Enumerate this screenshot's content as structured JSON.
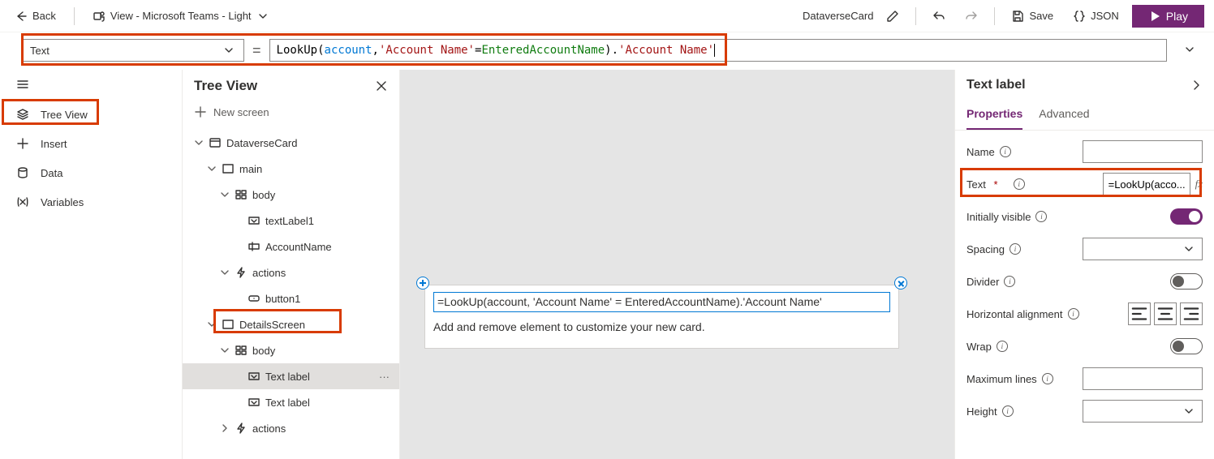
{
  "top": {
    "back": "Back",
    "view_label": "View - Microsoft Teams - Light",
    "app_name": "DataverseCard",
    "save": "Save",
    "json": "JSON",
    "play": "Play"
  },
  "formula": {
    "property_name": "Text",
    "prefix_fn": "LookUp(",
    "ident_account": "account",
    "comma1": ", ",
    "str1": "'Account Name'",
    "eq_op": " = ",
    "ident_entered": "EnteredAccountName",
    "close_dot": ").",
    "str2": "'Account Name'"
  },
  "left_nav": {
    "tree_view": "Tree View",
    "insert": "Insert",
    "data": "Data",
    "variables": "Variables"
  },
  "tree": {
    "title": "Tree View",
    "new_screen": "New screen",
    "nodes": {
      "root": "DataverseCard",
      "main": "main",
      "body1": "body",
      "textLabel1": "textLabel1",
      "accountName": "AccountName",
      "actions1": "actions",
      "button1": "button1",
      "detailsScreen": "DetailsScreen",
      "body2": "body",
      "text_label_sel": "Text label",
      "text_label2": "Text label",
      "actions2": "actions"
    }
  },
  "canvas": {
    "bound_text": "=LookUp(account, 'Account Name' = EnteredAccountName).'Account Name'",
    "add_remove": "Add and remove element to customize your new card."
  },
  "props": {
    "panel_title": "Text label",
    "tab_props": "Properties",
    "tab_adv": "Advanced",
    "name_label": "Name",
    "text_label": "Text",
    "text_value": "=LookUp(acco...",
    "fx_hint": "fx",
    "init_visible": "Initially visible",
    "spacing": "Spacing",
    "divider": "Divider",
    "halign": "Horizontal alignment",
    "wrap": "Wrap",
    "maxlines": "Maximum lines",
    "height": "Height"
  }
}
